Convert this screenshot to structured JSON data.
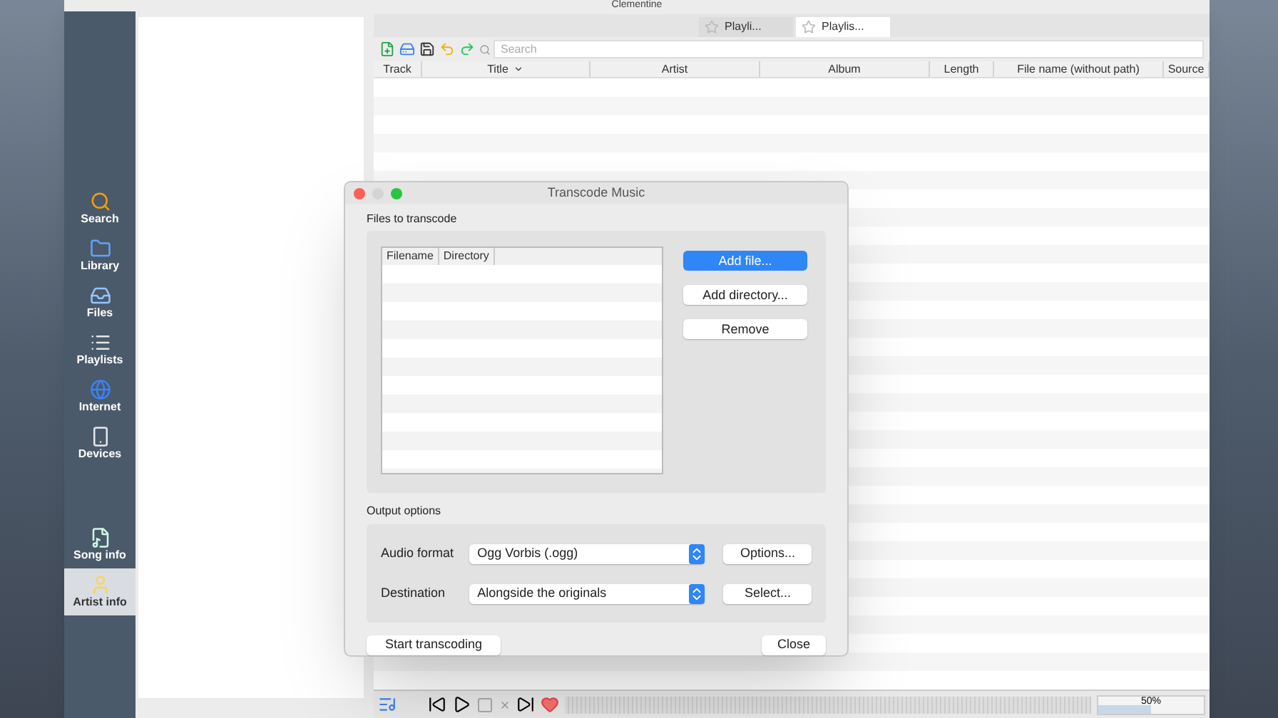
{
  "window": {
    "title": "Clementine"
  },
  "sidebar": {
    "items": [
      {
        "label": "Search",
        "selected": false
      },
      {
        "label": "Library",
        "selected": false
      },
      {
        "label": "Files",
        "selected": false
      },
      {
        "label": "Playlists",
        "selected": false
      },
      {
        "label": "Internet",
        "selected": false
      },
      {
        "label": "Devices",
        "selected": false
      },
      {
        "label": "Song info",
        "selected": false
      },
      {
        "label": "Artist info",
        "selected": true
      }
    ]
  },
  "playlist_tabs": [
    {
      "label": "Playli...",
      "selected": false
    },
    {
      "label": "Playlis...",
      "selected": true
    }
  ],
  "search": {
    "placeholder": "Search"
  },
  "playlist": {
    "columns": [
      "Track",
      "Title",
      "Artist",
      "Album",
      "Length",
      "File name (without path)",
      "Source"
    ]
  },
  "dialog": {
    "title": "Transcode Music",
    "files_section": "Files to transcode",
    "file_columns": [
      "Filename",
      "Directory"
    ],
    "file_buttons": [
      {
        "label": "Add file...",
        "default": true
      },
      {
        "label": "Add directory...",
        "default": false
      },
      {
        "label": "Remove",
        "default": false
      }
    ],
    "output_section": "Output options",
    "output_rows": [
      {
        "label": "Audio format",
        "value": "Ogg Vorbis (.ogg)",
        "button": "Options..."
      },
      {
        "label": "Destination",
        "value": "Alongside the originals",
        "button": "Select..."
      }
    ],
    "start_button": "Start transcoding",
    "close_button": "Close"
  },
  "player": {
    "volume": {
      "level": 0.5,
      "reading": "50%"
    }
  }
}
